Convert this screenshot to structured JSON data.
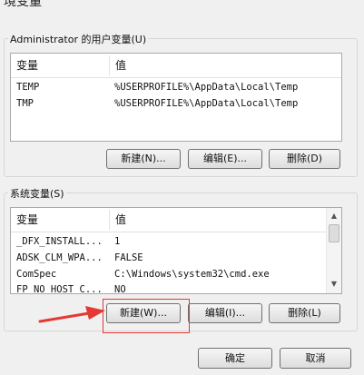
{
  "window": {
    "title": "境变量"
  },
  "user_section": {
    "label": "Administrator 的用户变量(U)",
    "headers": {
      "variable": "变量",
      "value": "值"
    },
    "rows": [
      {
        "variable": "TEMP",
        "value": "%USERPROFILE%\\AppData\\Local\\Temp"
      },
      {
        "variable": "TMP",
        "value": "%USERPROFILE%\\AppData\\Local\\Temp"
      }
    ],
    "buttons": {
      "new": "新建(N)...",
      "edit": "编辑(E)...",
      "delete": "删除(D)"
    }
  },
  "system_section": {
    "label": "系统变量(S)",
    "headers": {
      "variable": "变量",
      "value": "值"
    },
    "rows": [
      {
        "variable": "_DFX_INSTALL...",
        "value": "1"
      },
      {
        "variable": "ADSK_CLM_WPA...",
        "value": "FALSE"
      },
      {
        "variable": "ComSpec",
        "value": "C:\\Windows\\system32\\cmd.exe"
      },
      {
        "variable": "FP_NO_HOST_C...",
        "value": "NO"
      }
    ],
    "buttons": {
      "new": "新建(W)...",
      "edit": "编辑(I)...",
      "delete": "删除(L)"
    }
  },
  "dialog_buttons": {
    "ok": "确定",
    "cancel": "取消"
  },
  "annotation": {
    "color": "#e53935"
  },
  "icons": {
    "scroll_up": "scroll-up-icon",
    "scroll_down": "scroll-down-icon",
    "pointer": "red-arrow-icon"
  }
}
